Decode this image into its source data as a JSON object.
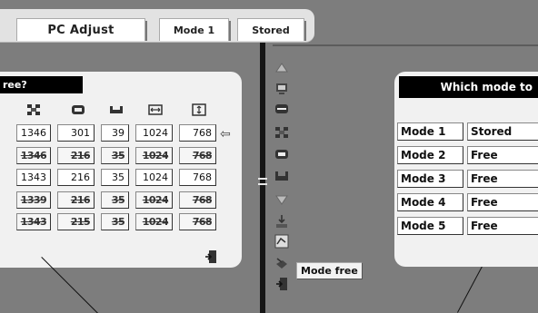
{
  "tabs": {
    "main": "PC Adjust",
    "mode": "Mode 1",
    "stored": "Stored"
  },
  "left_panel": {
    "title": "ree?",
    "column_icons": [
      "total-dots-icon",
      "horizontal-position-icon",
      "vertical-position-icon",
      "display-area-h-icon",
      "display-area-v-icon"
    ],
    "rows": [
      {
        "values": [
          "1346",
          "301",
          "39",
          "1024",
          "768"
        ],
        "state": "current"
      },
      {
        "values": [
          "1346",
          "216",
          "35",
          "1024",
          "768"
        ],
        "state": "garbled"
      },
      {
        "values": [
          "1343",
          "216",
          "35",
          "1024",
          "768"
        ],
        "state": "normal"
      },
      {
        "values": [
          "1339",
          "216",
          "35",
          "1024",
          "768"
        ],
        "state": "garbled"
      },
      {
        "values": [
          "1343",
          "215",
          "35",
          "1024",
          "768"
        ],
        "state": "garbled"
      }
    ]
  },
  "vertical_menu": {
    "items": [
      "scroll-up-icon",
      "auto-pc-adj-icon",
      "fine-sync-icon",
      "total-dots-icon",
      "horizontal-icon",
      "vertical-icon",
      "scroll-down-icon",
      "store-icon",
      "reset-icon",
      "mode-free-icon",
      "quit-icon"
    ],
    "tooltip": "Mode free"
  },
  "right_panel": {
    "title": "Which mode to",
    "modes": [
      {
        "name": "Mode 1",
        "state": "Stored"
      },
      {
        "name": "Mode 2",
        "state": "Free"
      },
      {
        "name": "Mode 3",
        "state": "Free"
      },
      {
        "name": "Mode 4",
        "state": "Free"
      },
      {
        "name": "Mode 5",
        "state": "Free"
      }
    ]
  },
  "colors": {
    "background": "#7d7d7d",
    "panel": "#f1f1f1",
    "title_bar": "#000000",
    "divider": "#161616"
  }
}
